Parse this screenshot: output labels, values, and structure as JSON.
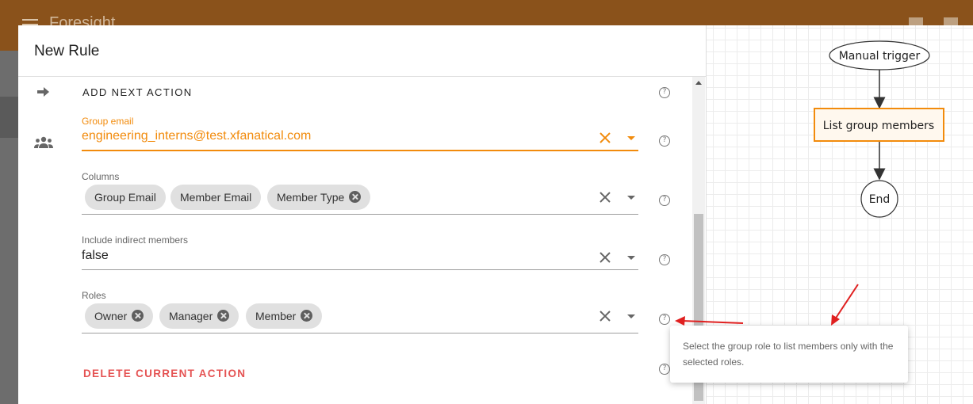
{
  "app": {
    "title": "Foresight"
  },
  "dialog": {
    "title": "New Rule",
    "add_next_action": "ADD NEXT ACTION",
    "delete_action": "DELETE CURRENT ACTION",
    "fields": {
      "group_email": {
        "label": "Group email",
        "value": "engineering_interns@test.xfanatical.com"
      },
      "columns": {
        "label": "Columns",
        "chips": [
          "Group Email",
          "Member Email",
          "Member Type"
        ]
      },
      "include_indirect": {
        "label": "Include indirect members",
        "value": "false"
      },
      "roles": {
        "label": "Roles",
        "chips": [
          "Owner",
          "Manager",
          "Member"
        ]
      }
    }
  },
  "flow": {
    "nodes": [
      "Manual trigger",
      "List group members",
      "End"
    ]
  },
  "tooltip": {
    "text": "Select the group role to list members only with the selected roles."
  },
  "colors": {
    "accent": "#f28b0c",
    "danger": "#e55353",
    "annotation": "#e02020",
    "appbar": "#8a521b"
  },
  "icons": {
    "help": "?",
    "clear": "×"
  }
}
